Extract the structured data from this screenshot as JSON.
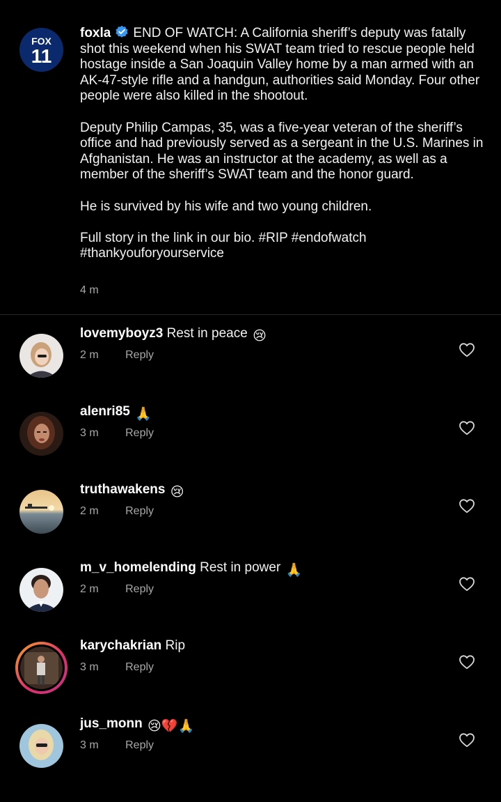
{
  "post": {
    "username": "foxla",
    "avatar_icon": "fox-11-logo",
    "avatar_text_top": "FOX",
    "avatar_text_bottom": "11",
    "verified_icon": "verified-badge-icon",
    "caption_paragraph_1": "END OF WATCH: A California sheriff’s deputy was fatally shot this weekend when his SWAT team tried to rescue people held hostage inside a San Joaquin Valley home by a man armed with an AK-47-style rifle and a handgun, authorities said Monday. Four other people were also killed in the shootout.",
    "caption_paragraph_2": "Deputy Philip Campas, 35, was a five-year veteran of the sheriff’s office and had previously served as a sergeant in the U.S. Marines in Afghanistan. He was an instructor at the academy, as well as a member of the sheriff’s SWAT team and the honor guard.",
    "caption_paragraph_3": "He is survived by his wife and two young children.",
    "caption_paragraph_4": "Full story in the link in our bio. #RIP #endofwatch #thankyouforyourservice",
    "time": "4 m"
  },
  "comments": [
    {
      "username": "lovemyboyz3",
      "text": "Rest in peace",
      "emojis": "😢",
      "time": "2 m",
      "reply_label": "Reply",
      "like_icon": "heart-outline-icon"
    },
    {
      "username": "alenri85",
      "text": "",
      "emojis": "🙏",
      "time": "3 m",
      "reply_label": "Reply",
      "like_icon": "heart-outline-icon"
    },
    {
      "username": "truthawakens",
      "text": "",
      "emojis": "😢",
      "time": "2 m",
      "reply_label": "Reply",
      "like_icon": "heart-outline-icon"
    },
    {
      "username": "m_v_homelending",
      "text": "Rest in power",
      "emojis": "🙏",
      "time": "2 m",
      "reply_label": "Reply",
      "like_icon": "heart-outline-icon"
    },
    {
      "username": "karychakrian",
      "text": "Rip",
      "emojis": "",
      "time": "3 m",
      "reply_label": "Reply",
      "like_icon": "heart-outline-icon"
    },
    {
      "username": "jus_monn",
      "text": "",
      "emojis": "😢💔🙏",
      "time": "3 m",
      "reply_label": "Reply",
      "like_icon": "heart-outline-icon"
    }
  ],
  "colors": {
    "background": "#000000",
    "text_primary": "#f2f2f2",
    "text_secondary": "#a8a8a8",
    "verified_blue": "#3897f0",
    "divider": "#262626",
    "story_ring": "#e1306c"
  }
}
